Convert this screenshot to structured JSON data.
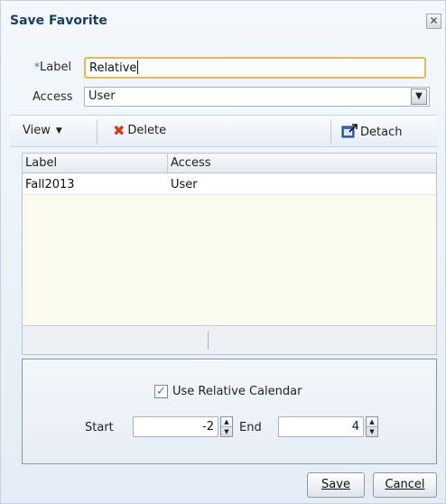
{
  "dialog": {
    "title": "Save Favorite",
    "close_symbol": "✕"
  },
  "form": {
    "label_required_marker": "*",
    "label_label": "Label",
    "label_value": "Relative",
    "access_label": "Access",
    "access_value": "User"
  },
  "toolbar": {
    "view_label": "View",
    "delete_label": "Delete",
    "detach_label": "Detach"
  },
  "table": {
    "columns": [
      "Label",
      "Access"
    ],
    "rows": [
      {
        "label": "Fall2013",
        "access": "User"
      }
    ]
  },
  "calendar": {
    "use_relative_label": "Use Relative Calendar",
    "use_relative_checked": true,
    "start_label": "Start",
    "start_value": "-2",
    "end_label": "End",
    "end_value": "4"
  },
  "buttons": {
    "save_label": "Save",
    "cancel_label": "Cancel"
  },
  "colors": {
    "title": "#1b3e66",
    "input_focus_border": "#e7b75e",
    "delete_icon": "#d13b1f",
    "checkmark": "#2a9d2a"
  },
  "icons": {
    "close": "close-icon",
    "delete": "delete-x-icon",
    "detach": "detach-icon",
    "dropdown": "chevron-down-icon",
    "spinner_up": "spinner-up-icon",
    "spinner_down": "spinner-down-icon",
    "checkbox": "checkmark-icon"
  }
}
